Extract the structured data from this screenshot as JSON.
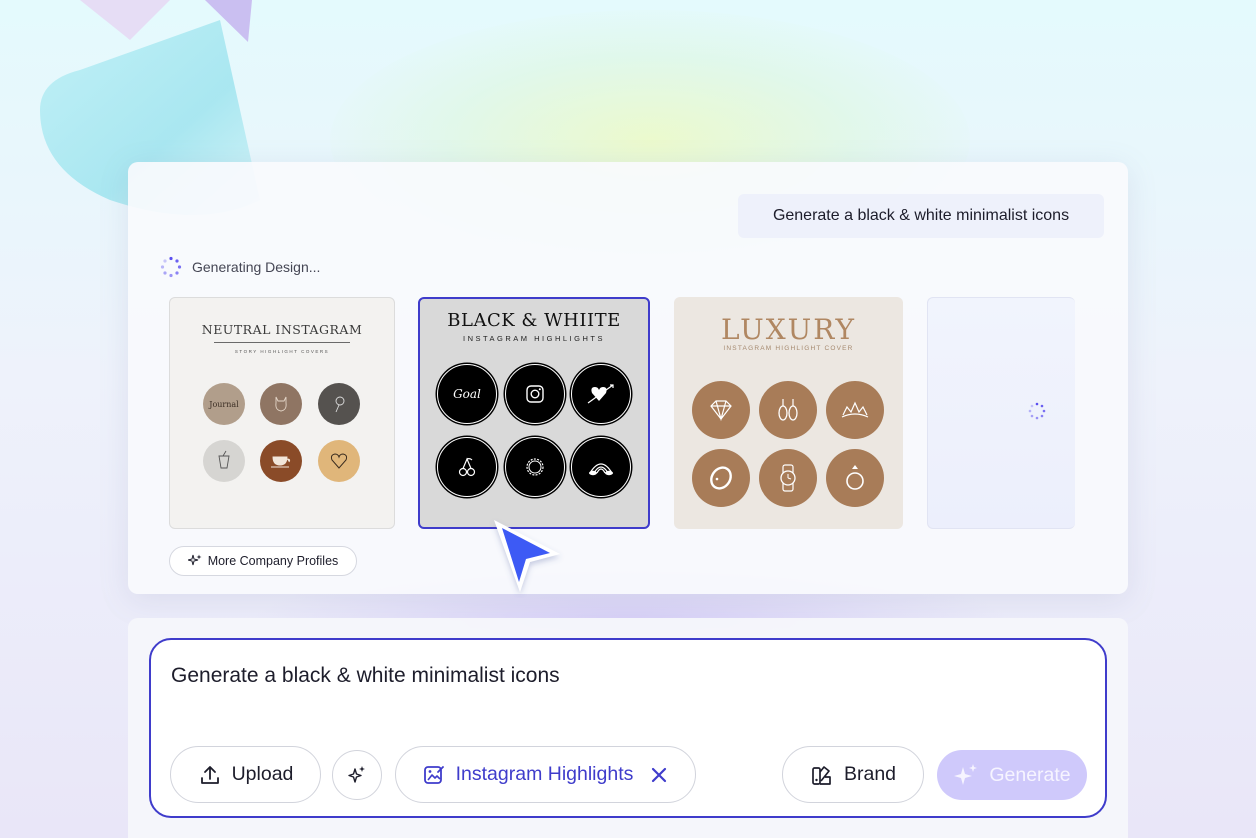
{
  "chat": {
    "prompt_bubble": "Generate a black & white minimalist icons",
    "status_text": "Generating Design...",
    "more_button_label": "More Company Profiles"
  },
  "templates": [
    {
      "title": "NEUTRAL INSTAGRAM",
      "subtitle": "STORY HIGHLIGHT COVERS",
      "icons": [
        "journal",
        "cat-icon",
        "flower-icon",
        "drink-icon",
        "coffee-cup-icon",
        "heart-icon"
      ],
      "icon_text": "Journal"
    },
    {
      "title": "BLACK & WHIITE",
      "subtitle": "INSTAGRAM HIGHLIGHTS",
      "icons": [
        "goal",
        "instagram-icon",
        "heart-arrow-icon",
        "cherry-icon",
        "sun-icon",
        "rainbow-icon"
      ],
      "icon_text": "Goal"
    },
    {
      "title": "LUXURY",
      "subtitle": "INSTAGRAM HIGHLIGHT COVER",
      "icons": [
        "diamond-icon",
        "earrings-icon",
        "tiara-icon",
        "bracelet-icon",
        "watch-icon",
        "ring-icon"
      ]
    },
    {
      "state": "loading"
    }
  ],
  "composer": {
    "input_value": "Generate a black & white minimalist icons",
    "upload_label": "Upload",
    "tag_label": "Instagram Highlights",
    "brand_label": "Brand",
    "generate_label": "Generate"
  },
  "colors": {
    "accent": "#3f3ccb",
    "generate_disabled": "#cfc9fb"
  }
}
